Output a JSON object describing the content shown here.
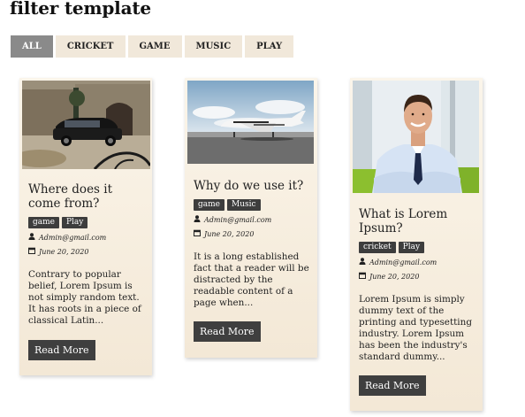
{
  "page": {
    "title": "filter template"
  },
  "filters": [
    {
      "label": "ALL",
      "active": true
    },
    {
      "label": "CRICKET",
      "active": false
    },
    {
      "label": "GAME",
      "active": false
    },
    {
      "label": "MUSIC",
      "active": false
    },
    {
      "label": "PLAY",
      "active": false
    }
  ],
  "cards": [
    {
      "image": "luxury-car-at-villa-photo",
      "title": "Where does it come from?",
      "tags": [
        "game",
        "Play"
      ],
      "author": "Admin@gmail.com",
      "date": "June 20, 2020",
      "excerpt": "Contrary to popular belief, Lorem Ipsum is not simply random text. It has roots in a piece of classical Latin...",
      "button": "Read More"
    },
    {
      "image": "private-jet-photo",
      "title": "Why do we use it?",
      "tags": [
        "game",
        "Music"
      ],
      "author": "Admin@gmail.com",
      "date": "June 20, 2020",
      "excerpt": "It is a long established fact that a reader will be distracted by the readable content of a page when...",
      "button": "Read More"
    },
    {
      "image": "smiling-businessman-photo",
      "title": "What is Lorem Ipsum?",
      "tags": [
        "cricket",
        "Play"
      ],
      "author": "Admin@gmail.com",
      "date": "June 20, 2020",
      "excerpt": "Lorem Ipsum is simply dummy text of the printing and typesetting industry. Lorem Ipsum has been the industry's standard dummy...",
      "button": "Read More"
    }
  ],
  "icons": {
    "author": "user-icon",
    "date": "calendar-icon"
  },
  "colors": {
    "active_filter": "#8a8a8a",
    "filter_bg": "#f1e8da",
    "card_bg": "#f6eddd",
    "tag_bg": "#3d3d3d",
    "button_bg": "#3f3f3f"
  }
}
